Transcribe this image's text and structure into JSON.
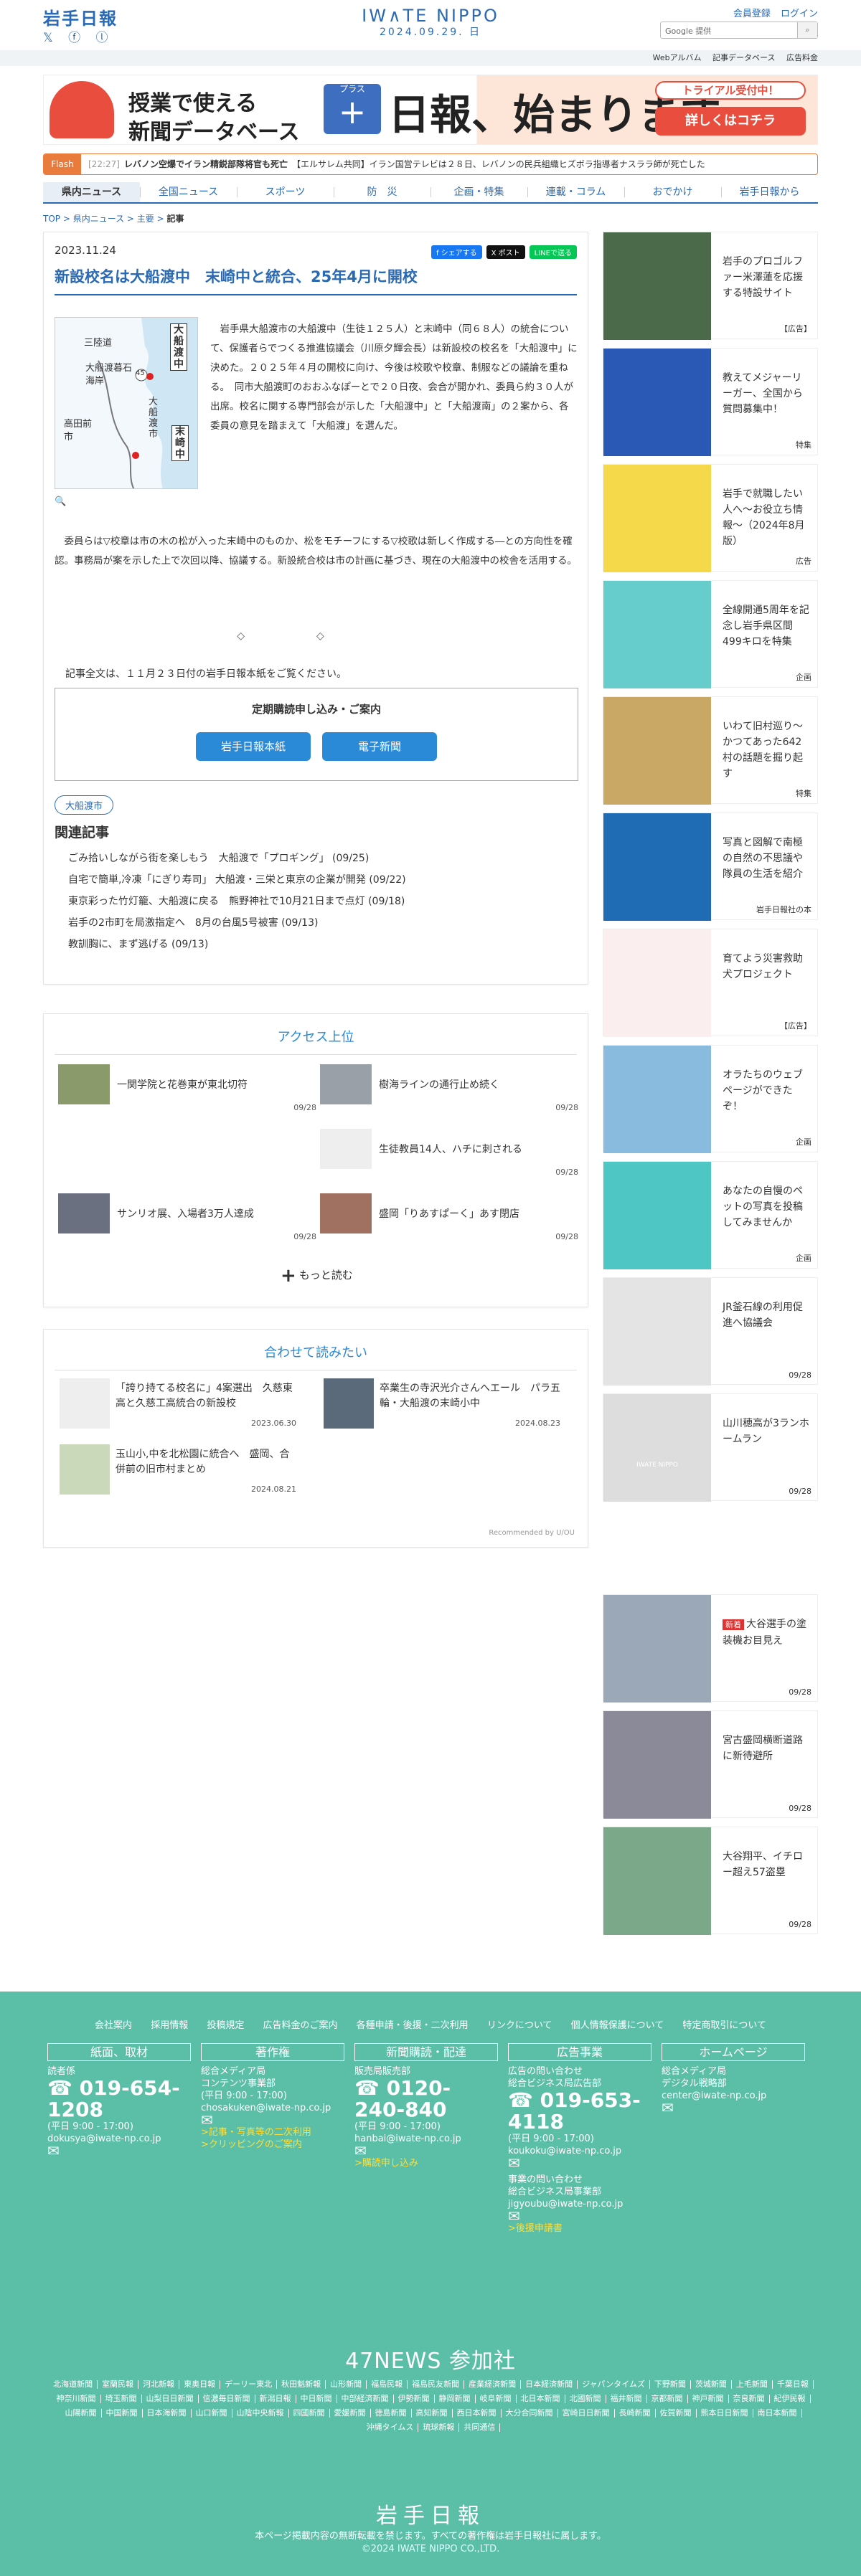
{
  "header": {
    "logo": "岩手日報",
    "social": "𝕏 ⓕ ⓛ",
    "brand": "IW∧TE NIPPO",
    "date": "2024.09.29. 日",
    "links": [
      "会員登録",
      "ログイン"
    ],
    "search_placeholder": "Google 提供",
    "sublinks": [
      "Webアルバム",
      "記事データベース",
      "広告料金"
    ]
  },
  "banner": {
    "line1": "授業で使える",
    "line2": "新聞データベース",
    "plus": "+",
    "plus_label": "プラス",
    "nippo": "日報、始まります。",
    "trial": "トライアル受付中！",
    "more": "詳しくはコチラ"
  },
  "flash": {
    "label": "Flash",
    "time": "[22:27]",
    "text": "レバノン空爆でイラン精鋭部隊将官も死亡",
    "text2": "【エルサレム共同】イラン国営テレビは２８日、レバノンの民兵組織ヒズボラ指導者ナスララ師が死亡した"
  },
  "nav": [
    "県内ニュース",
    "全国ニュース",
    "スポーツ",
    "防　災",
    "企画・特集",
    "連載・コラム",
    "おでかけ",
    "岩手日報から"
  ],
  "crumbs": {
    "top": "TOP",
    "a": "県内ニュース",
    "b": "主要",
    "current": "記事"
  },
  "article": {
    "date": "2023.11.24",
    "share": [
      "f シェアする",
      "X ポスト",
      "LINEで送る"
    ],
    "title": "新設校名は大船渡中　末崎中と統合、25年4月に開校",
    "p1": "岩手県大船渡市の大船渡中（生徒１２５人）と末崎中（同６８人）の統合について、保護者らでつくる推進協議会（川原夕輝会長）は新設校の校名を「大船渡中」に決めた。２０２５年４月の開校に向け、今後は校歌や校章、制服などの議論を重ねる。　同市大船渡町のおおふなぽーとで２０日夜、会合が開かれ、委員ら約３０人が出席。校名に関する専門部会が示した「大船渡中」と「大船渡南」の２案から、各委員の意見を踏まえて「大船渡」を選んだ。",
    "p2": "委員らは▽校章は市の木の松が入った末崎中のものか、松をモチーフにする▽校歌は新しく作成する―との方向性を確認。事務局が案を示した上で次回以降、協議する。新設統合校は市の計画に基づき、現在の大船渡中の校舎を活用する。",
    "dia": "◇◇",
    "full": "記事全文は、１１月２３日付の岩手日報本紙をご覧ください。",
    "sub_title": "定期購読申し込み・ご案内",
    "sub_btns": [
      "岩手日報本紙",
      "電子新聞"
    ],
    "tag": "大船渡市",
    "rel_head": "関連記事",
    "related": [
      "ごみ拾いしながら街を楽しもう　大船渡で「プロギング」 (09/25)",
      "自宅で簡単,冷凍「にぎり寿司」 大船渡・三栄と東京の企業が開発 (09/22)",
      "東京彩った竹灯籠、大船渡に戻る　熊野神社で10月21日まで点灯 (09/18)",
      "岩手の2市町を局激指定へ　8月の台風5号被害 (09/13)",
      "教訓胸に、まず逃げる (09/13)"
    ],
    "map": {
      "l1": "三陸道",
      "l2": "大船渡暮石海岸",
      "l3": "大船渡市",
      "l4": "高田前市",
      "l5": "大船渡中",
      "l6": "末崎中",
      "l7": "45"
    }
  },
  "access": {
    "title": "アクセス上位",
    "items": [
      {
        "t": "一関学院と花巻東が東北切符",
        "d": "09/28"
      },
      {
        "t": "樹海ラインの通行止め続く",
        "d": "09/28"
      },
      {
        "t": "",
        "d": ""
      },
      {
        "t": "生徒教員14人、ハチに刺される",
        "d": "09/28"
      },
      {
        "t": "サンリオ展、入場者3万人達成",
        "d": "09/28"
      },
      {
        "t": "盛岡「りあすぱーく」あす閉店",
        "d": "09/28"
      }
    ],
    "more": "もっと読む"
  },
  "also": {
    "title": "合わせて読みたい",
    "items": [
      {
        "t": "「誇り持てる校名に」4案選出　久慈東高と久慈工高統合の新設校",
        "d": "2023.06.30"
      },
      {
        "t": "卒業生の寺沢光介さんへエール　パラ五輪・大船渡の末崎小中",
        "d": "2024.08.23"
      },
      {
        "t": "玉山小,中を北松園に統合へ　盛岡、合併前の旧市村まとめ",
        "d": "2024.08.21"
      }
    ],
    "rec": "Recommended by U∕OU"
  },
  "side": [
    {
      "t": "岩手のプロゴルファー米澤蓮を応援する特設サイト",
      "l": "【広告】",
      "c": "#4a6a4a"
    },
    {
      "t": "教えてメジャーリーガー、全国から質問募集中！",
      "l": "特集",
      "c": "#2a58b5"
    },
    {
      "t": "岩手で就職したい人へ〜お役立ち情報〜（2024年8月版）",
      "l": "広告",
      "c": "#f6d94b"
    },
    {
      "t": "全線開通5周年を記念し岩手県区間499キロを特集",
      "l": "企画",
      "c": "#6cc"
    },
    {
      "t": "いわて旧村巡り〜かつてあった642村の話題を掘り起す",
      "l": "特集",
      "c": "#c9a866"
    },
    {
      "t": "写真と図解で南極の自然の不思議や隊員の生活を紹介",
      "l": "岩手日報社の本",
      "c": "#1f6cb5"
    },
    {
      "t": "育てよう災害救助犬プロジェクト",
      "l": "【広告】",
      "c": "#fff"
    },
    {
      "t": "オラたちのウェブページができたぞ！",
      "l": "企画",
      "c": "#8bd"
    },
    {
      "t": "あなたの自慢のペットの写真を投稿してみませんか",
      "l": "企画",
      "c": "#4ec6c4"
    },
    {
      "t": "JR釜石線の利用促進へ協議会",
      "l": "09/28",
      "c": "#ddd"
    },
    {
      "t": "山川穂高が3ランホームラン",
      "l": "09/28",
      "c": "#ddd"
    },
    {
      "t": "大谷選手の塗装機お目見え",
      "l": "09/28",
      "c": "#9ab"
    },
    {
      "t": "宮古盛岡横断道路に新待避所",
      "l": "09/28",
      "c": "#889"
    },
    {
      "t": "大谷翔平、イチロー超え57盗塁",
      "l": "09/28",
      "c": "#7a8"
    }
  ],
  "side_new_label": "新着",
  "side_logo": "IWATE NIPPO",
  "footer": {
    "links": [
      "会社案内",
      "採用情報",
      "投稿規定",
      "広告料金のご案内",
      "各種申請・後援・二次利用",
      "リンクについて",
      "個人情報保護について",
      "特定商取引について"
    ],
    "cols": [
      {
        "h": "紙面、取材",
        "lines": [
          "読者係"
        ],
        "phone": "019-654-1208",
        "hours": "(平日 9:00 - 17:00)",
        "mail": "dokusya@iwate-np.co.jp",
        "links": []
      },
      {
        "h": "著作権",
        "lines": [
          "総合メディア局",
          "コンテンツ事業部",
          "(平日 9:00 - 17:00)"
        ],
        "phone": "",
        "hours": "",
        "mail": "chosakuken@iwate-np.co.jp",
        "links": [
          "記事・写真等の二次利用",
          "クリッピングのご案内"
        ]
      },
      {
        "h": "新聞購読・配達",
        "lines": [
          "販売局販売部"
        ],
        "phone": "0120-240-840",
        "hours": "(平日 9:00 - 17:00)",
        "mail": "hanbai@iwate-np.co.jp",
        "links": [
          "購読申し込み"
        ]
      },
      {
        "h": "広告事業",
        "lines": [
          "広告の問い合わせ",
          "総合ビジネス局広告部"
        ],
        "phone": "019-653-4118",
        "hours": "(平日 9:00 - 17:00)",
        "mail": "koukoku@iwate-np.co.jp",
        "links": [
          "後援申請書"
        ],
        "extra": [
          "事業の問い合わせ",
          "総合ビジネス局事業部",
          "jigyoubu@iwate-np.co.jp"
        ]
      },
      {
        "h": "ホームページ",
        "lines": [
          "総合メディア局",
          "デジタル戦略部"
        ],
        "phone": "",
        "hours": "",
        "mail": "center@iwate-np.co.jp",
        "links": []
      }
    ],
    "n47": "47NEWS 参加社",
    "members": [
      "北海道新聞",
      "室蘭民報",
      "河北新報",
      "東奥日報",
      "デーリー東北",
      "秋田魁新報",
      "山形新聞",
      "福島民報",
      "福島民友新聞",
      "産業経済新聞",
      "日本経済新聞",
      "ジャパンタイムズ",
      "下野新聞",
      "茨城新聞",
      "上毛新聞",
      "千葉日報",
      "神奈川新聞",
      "埼玉新聞",
      "山梨日日新聞",
      "信濃毎日新聞",
      "新潟日報",
      "中日新聞",
      "中部経済新聞",
      "伊勢新聞",
      "静岡新聞",
      "岐阜新聞",
      "北日本新聞",
      "北國新聞",
      "福井新聞",
      "京都新聞",
      "神戸新聞",
      "奈良新聞",
      "紀伊民報",
      "山陽新聞",
      "中国新聞",
      "日本海新聞",
      "山口新聞",
      "山陰中央新報",
      "四國新聞",
      "愛媛新聞",
      "徳島新聞",
      "高知新聞",
      "西日本新聞",
      "大分合同新聞",
      "宮崎日日新聞",
      "長崎新聞",
      "佐賀新聞",
      "熊本日日新聞",
      "南日本新聞",
      "沖縄タイムス",
      "琉球新報",
      "共同通信"
    ],
    "logo": "岩手日報",
    "note": "本ページ掲載内容の無断転載を禁じます。すべての著作権は岩手日報社に属します。",
    "copy": "©2024 IWATE NIPPO CO.,LTD."
  }
}
